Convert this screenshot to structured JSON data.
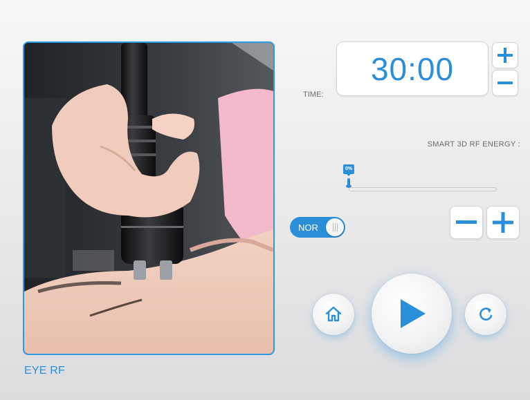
{
  "treatment": {
    "title": "EYE RF"
  },
  "timer": {
    "label": "TIME:",
    "value": "30:00"
  },
  "energy": {
    "label": "SMART 3D RF ENERGY :",
    "level_percent": 0,
    "value_text": "0%"
  },
  "mode_toggle": {
    "label": "NOR",
    "on": true
  },
  "controls": {
    "time_increase_icon": "plus-icon",
    "time_decrease_icon": "minus-icon",
    "energy_decrease_icon": "minus-icon",
    "energy_increase_icon": "plus-icon",
    "home_icon": "home-icon",
    "play_icon": "play-icon",
    "reset_icon": "refresh-icon"
  },
  "colors": {
    "accent": "#2a8fd8",
    "frame": "#2e9ae6",
    "text_muted": "#6a6a6a"
  }
}
